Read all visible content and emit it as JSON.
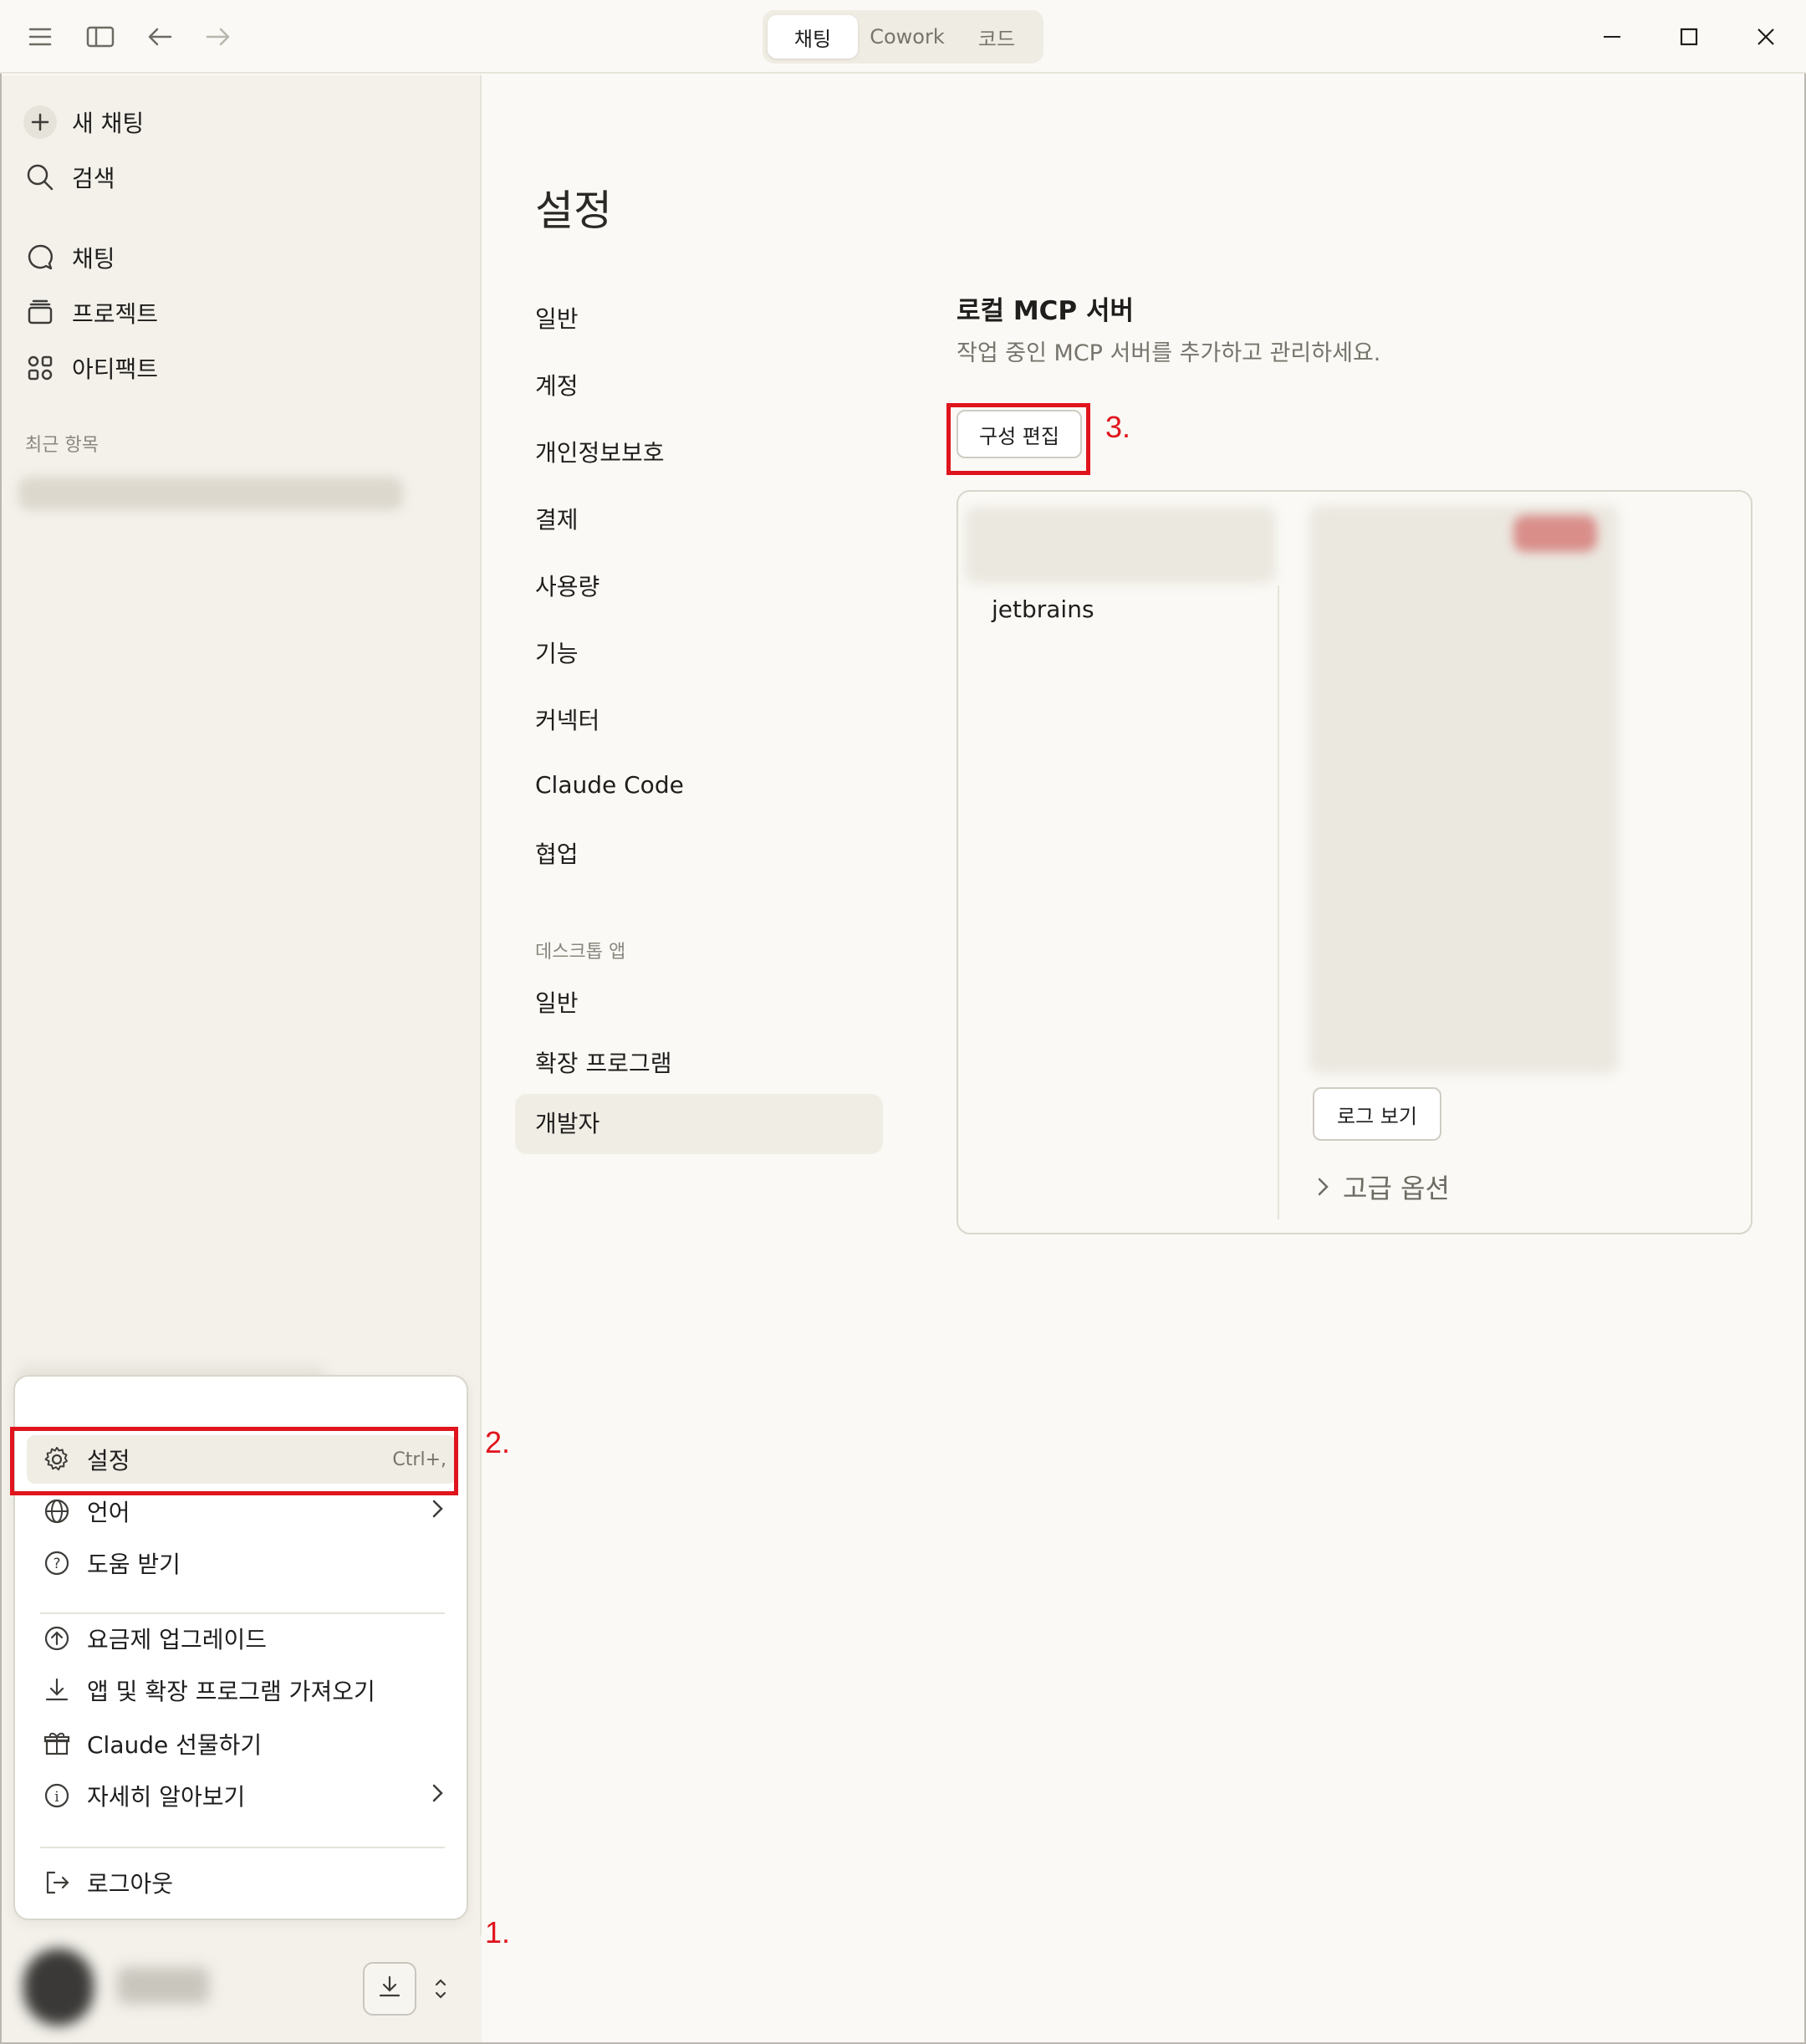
{
  "titlebar": {
    "tabs": [
      {
        "label": "채팅",
        "active": true
      },
      {
        "label": "Cowork",
        "active": false
      },
      {
        "label": "코드",
        "active": false
      }
    ]
  },
  "sidebar": {
    "new_chat": "새 채팅",
    "search": "검색",
    "nav": [
      {
        "label": "채팅",
        "icon": "chat-icon"
      },
      {
        "label": "프로젝트",
        "icon": "project-icon"
      },
      {
        "label": "아티팩트",
        "icon": "artifact-icon"
      }
    ],
    "recent_label": "최근 항목"
  },
  "menu": {
    "settings": {
      "label": "설정",
      "shortcut": "Ctrl+,"
    },
    "language": "언어",
    "help": "도움 받기",
    "upgrade": "요금제 업그레이드",
    "get_apps": "앱 및 확장 프로그램 가져오기",
    "gift": "Claude 선물하기",
    "learn_more": "자세히 알아보기",
    "logout": "로그아웃"
  },
  "settings": {
    "title": "설정",
    "nav": [
      "일반",
      "계정",
      "개인정보보호",
      "결제",
      "사용량",
      "기능",
      "커넥터",
      "Claude Code",
      "협업"
    ],
    "desktop_section": "데스크톱 앱",
    "desktop_nav": [
      "일반",
      "확장 프로그램",
      "개발자"
    ],
    "active_item": "개발자"
  },
  "developer": {
    "section_title": "로컬 MCP 서버",
    "section_desc": "작업 중인 MCP 서버를 추가하고 관리하세요.",
    "edit_config": "구성 편집",
    "servers": [
      "jetbrains"
    ],
    "view_logs": "로그 보기",
    "advanced": "고급 옵션"
  },
  "annotations": {
    "step1": "1.",
    "step2": "2.",
    "step3": "3.",
    "color": "#e0141c"
  }
}
